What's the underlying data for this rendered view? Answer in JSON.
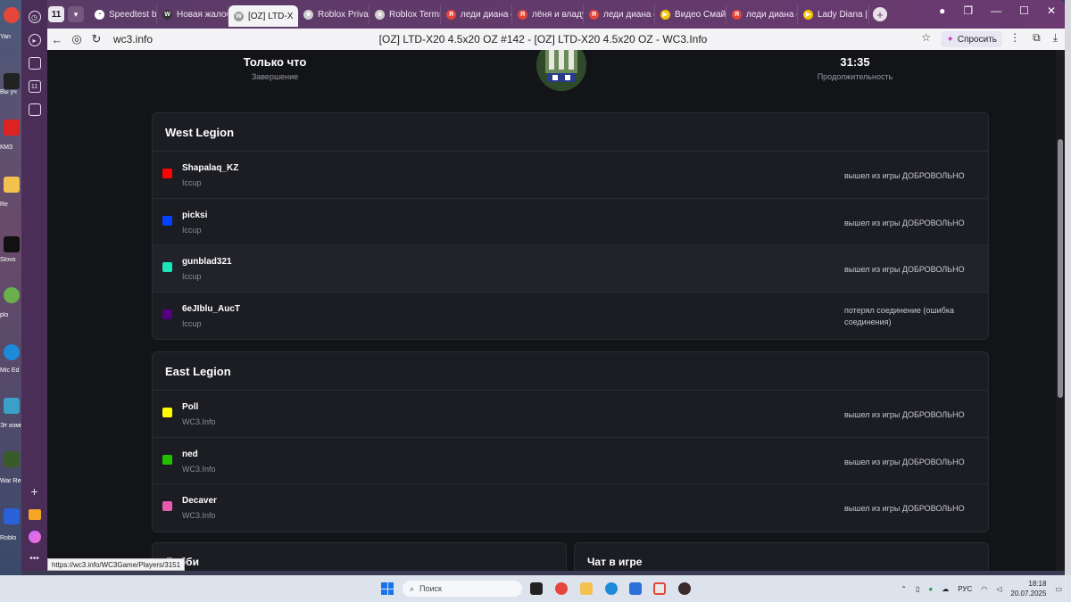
{
  "desktop": {
    "labels": [
      "Yan",
      "Вы уч",
      "КМЗ",
      "Re",
      "Slovo",
      "plo",
      "Mic Ed",
      "Эт комп",
      "War Reig",
      "Roblo"
    ]
  },
  "browser": {
    "tab_counter": "11",
    "tabs": [
      {
        "label": "Speedtest by",
        "icon": "speedtest-icon",
        "color": "#ffffff",
        "glyph": "◔"
      },
      {
        "label": "Новая жалоб",
        "icon": "wc3-icon",
        "color": "#333333",
        "glyph": "W"
      },
      {
        "label": "[OZ] LTD-X",
        "icon": "wc3-icon",
        "color": "#9a9a9a",
        "glyph": "W",
        "active": true
      },
      {
        "label": "Roblox Privac",
        "icon": "roblox-icon",
        "color": "#cfcfcf",
        "glyph": "■"
      },
      {
        "label": "Roblox Terms",
        "icon": "roblox-icon",
        "color": "#cfcfcf",
        "glyph": "■"
      },
      {
        "label": "леди диана с",
        "icon": "yandex-icon",
        "color": "#e5463b",
        "glyph": "Я"
      },
      {
        "label": "лёня и владу",
        "icon": "yandex-icon",
        "color": "#e5463b",
        "glyph": "Я"
      },
      {
        "label": "леди диана с",
        "icon": "yandex-icon",
        "color": "#e5463b",
        "glyph": "Я"
      },
      {
        "label": "Видео Смайл",
        "icon": "play-icon",
        "color": "#f5c400",
        "glyph": "▶"
      },
      {
        "label": "леди диана с",
        "icon": "yandex-icon",
        "color": "#e5463b",
        "glyph": "Я"
      },
      {
        "label": "Lady Diana | J",
        "icon": "play-icon",
        "color": "#f5c400",
        "glyph": "▶"
      }
    ],
    "url": "wc3.info",
    "page_title": "[OZ] LTD-X20 4.5x20 OZ #142 - [OZ] LTD-X20 4.5x20 OZ - WC3.Info",
    "ask_label": "Спросить",
    "status_url": "https://wc3.info/WC3Game/Players/3151"
  },
  "summary": {
    "ended_value": "Только что",
    "ended_label": "Завершение",
    "duration_value": "31:35",
    "duration_label": "Продолжительность"
  },
  "teams": [
    {
      "name": "West Legion",
      "players": [
        {
          "name": "Shapalaq_KZ",
          "realm": "Iccup",
          "color": "#ff0303",
          "status": "вышел из игры ДОБРОВОЛЬНО"
        },
        {
          "name": "picksi",
          "realm": "Iccup",
          "color": "#0042ff",
          "status": "вышел из игры ДОБРОВОЛЬНО"
        },
        {
          "name": "gunblad321",
          "realm": "Iccup",
          "color": "#1ce6b9",
          "status": "вышел из игры ДОБРОВОЛЬНО"
        },
        {
          "name": "6eJIblu_AucT",
          "realm": "Iccup",
          "color": "#540081",
          "status": "потерял соединение (ошибка соединения)"
        }
      ]
    },
    {
      "name": "East Legion",
      "players": [
        {
          "name": "Poll",
          "realm": "WC3.Info",
          "color": "#fffc01",
          "status": "вышел из игры ДОБРОВОЛЬНО"
        },
        {
          "name": "ned",
          "realm": "WC3.Info",
          "color": "#20c000",
          "status": "вышел из игры ДОБРОВОЛЬНО"
        },
        {
          "name": "Decaver",
          "realm": "WC3.Info",
          "color": "#e55bb0",
          "status": "вышел из игры ДОБРОВОЛЬНО"
        }
      ]
    }
  ],
  "bottom_panels": {
    "lobby_title": "Лобби",
    "chat_title": "Чат в игре"
  },
  "taskbar": {
    "search_placeholder": "Поиск",
    "language": "РУС",
    "time": "18:18",
    "date": "20.07.2025"
  }
}
